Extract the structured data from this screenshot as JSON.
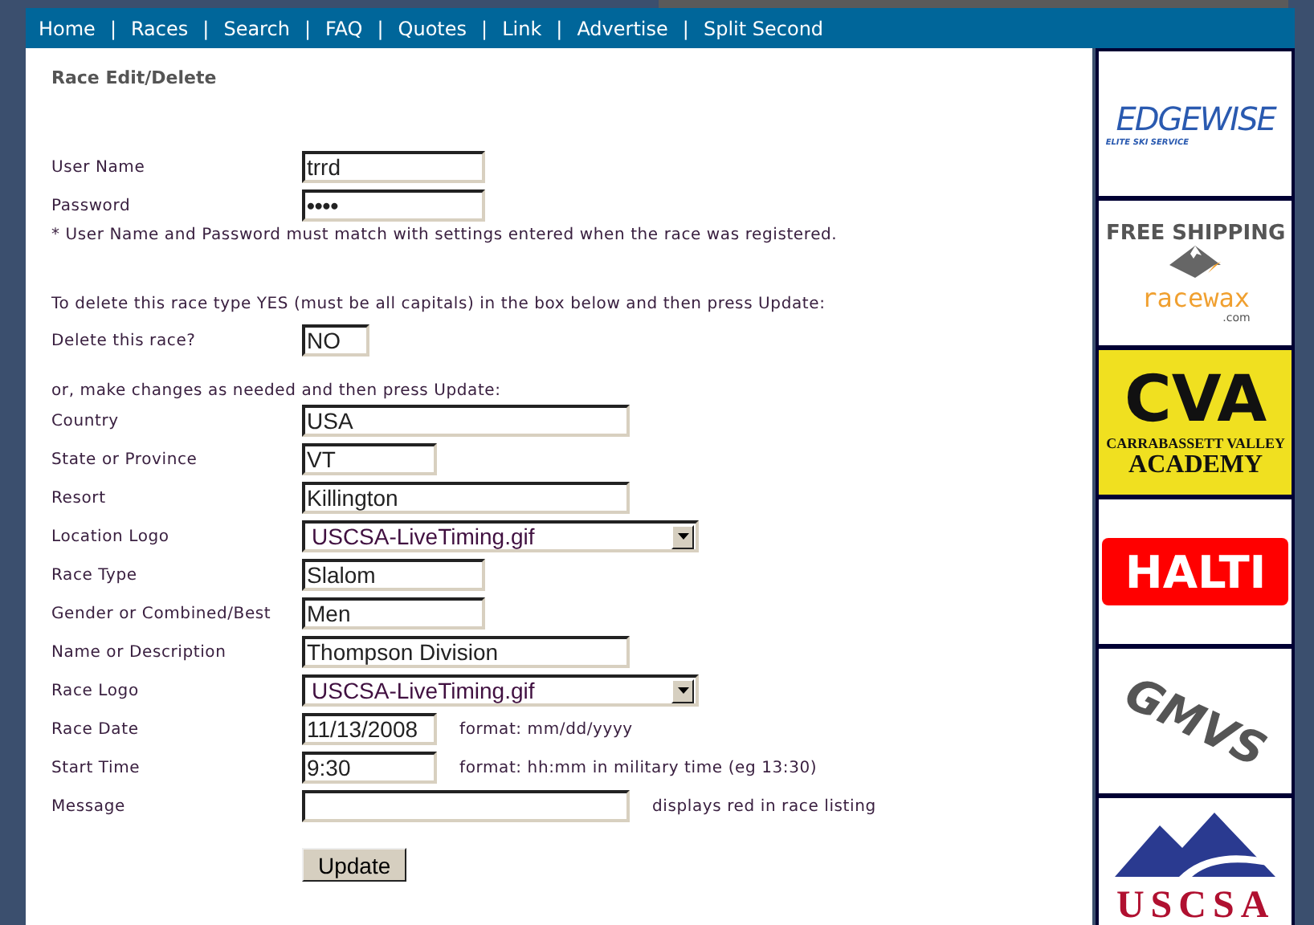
{
  "nav": {
    "separator": "|",
    "items": [
      "Home",
      "Races",
      "Search",
      "FAQ",
      "Quotes",
      "Link",
      "Advertise",
      "Split Second"
    ]
  },
  "title": "Race Edit/Delete",
  "login": [
    {
      "label": "User Name",
      "kind": "medium",
      "value": "trrd"
    },
    {
      "label": "Password",
      "kind": "password",
      "value": "••••"
    }
  ],
  "login_note": "* User Name and Password must match with settings entered when the race was registered.",
  "delete_instruction": "To delete this race type YES (must be all capitals) in the box below and then press Update:",
  "delete": {
    "label": "Delete this race?",
    "kind": "tiny",
    "value": "NO"
  },
  "edit_instruction": "or, make changes as needed and then press Update:",
  "fields": [
    {
      "label": "Country",
      "kind": "long",
      "value": "USA"
    },
    {
      "label": "State or Province",
      "kind": "short",
      "value": "VT"
    },
    {
      "label": "Resort",
      "kind": "long",
      "value": "Killington"
    },
    {
      "label": "Location Logo",
      "kind": "select",
      "value": "USCSA-LiveTiming.gif"
    },
    {
      "label": "Race Type",
      "kind": "medium",
      "value": "Slalom"
    },
    {
      "label": "Gender or Combined/Best",
      "kind": "medium",
      "value": "Men"
    },
    {
      "label": "Name or Description",
      "kind": "long",
      "value": "Thompson Division"
    },
    {
      "label": "Race Logo",
      "kind": "select",
      "value": "USCSA-LiveTiming.gif"
    },
    {
      "label": "Race Date",
      "kind": "short",
      "value": "11/13/2008",
      "hint": "format: mm/dd/yyyy"
    },
    {
      "label": "Start Time",
      "kind": "short",
      "value": "9:30",
      "hint": "format: hh:mm in military time (eg 13:30)"
    },
    {
      "label": "Message",
      "kind": "long",
      "hint": "displays red in race listing"
    }
  ],
  "submit": "Update",
  "ads": [
    {
      "kind": "edgewise",
      "texts": [
        "EDGEWISE",
        "ELITE SKI SERVICE"
      ]
    },
    {
      "kind": "racewax",
      "texts": [
        "FREE SHIPPING",
        "racewax",
        ".com"
      ]
    },
    {
      "kind": "cva",
      "texts": [
        "CVA",
        "CARRABASSETT VALLEY",
        "ACADEMY"
      ]
    },
    {
      "kind": "halti",
      "texts": [
        "HALTI"
      ]
    },
    {
      "kind": "gmvs",
      "texts": [
        "GMVS"
      ]
    },
    {
      "kind": "uscsa",
      "texts": [
        "USCSA"
      ]
    }
  ]
}
